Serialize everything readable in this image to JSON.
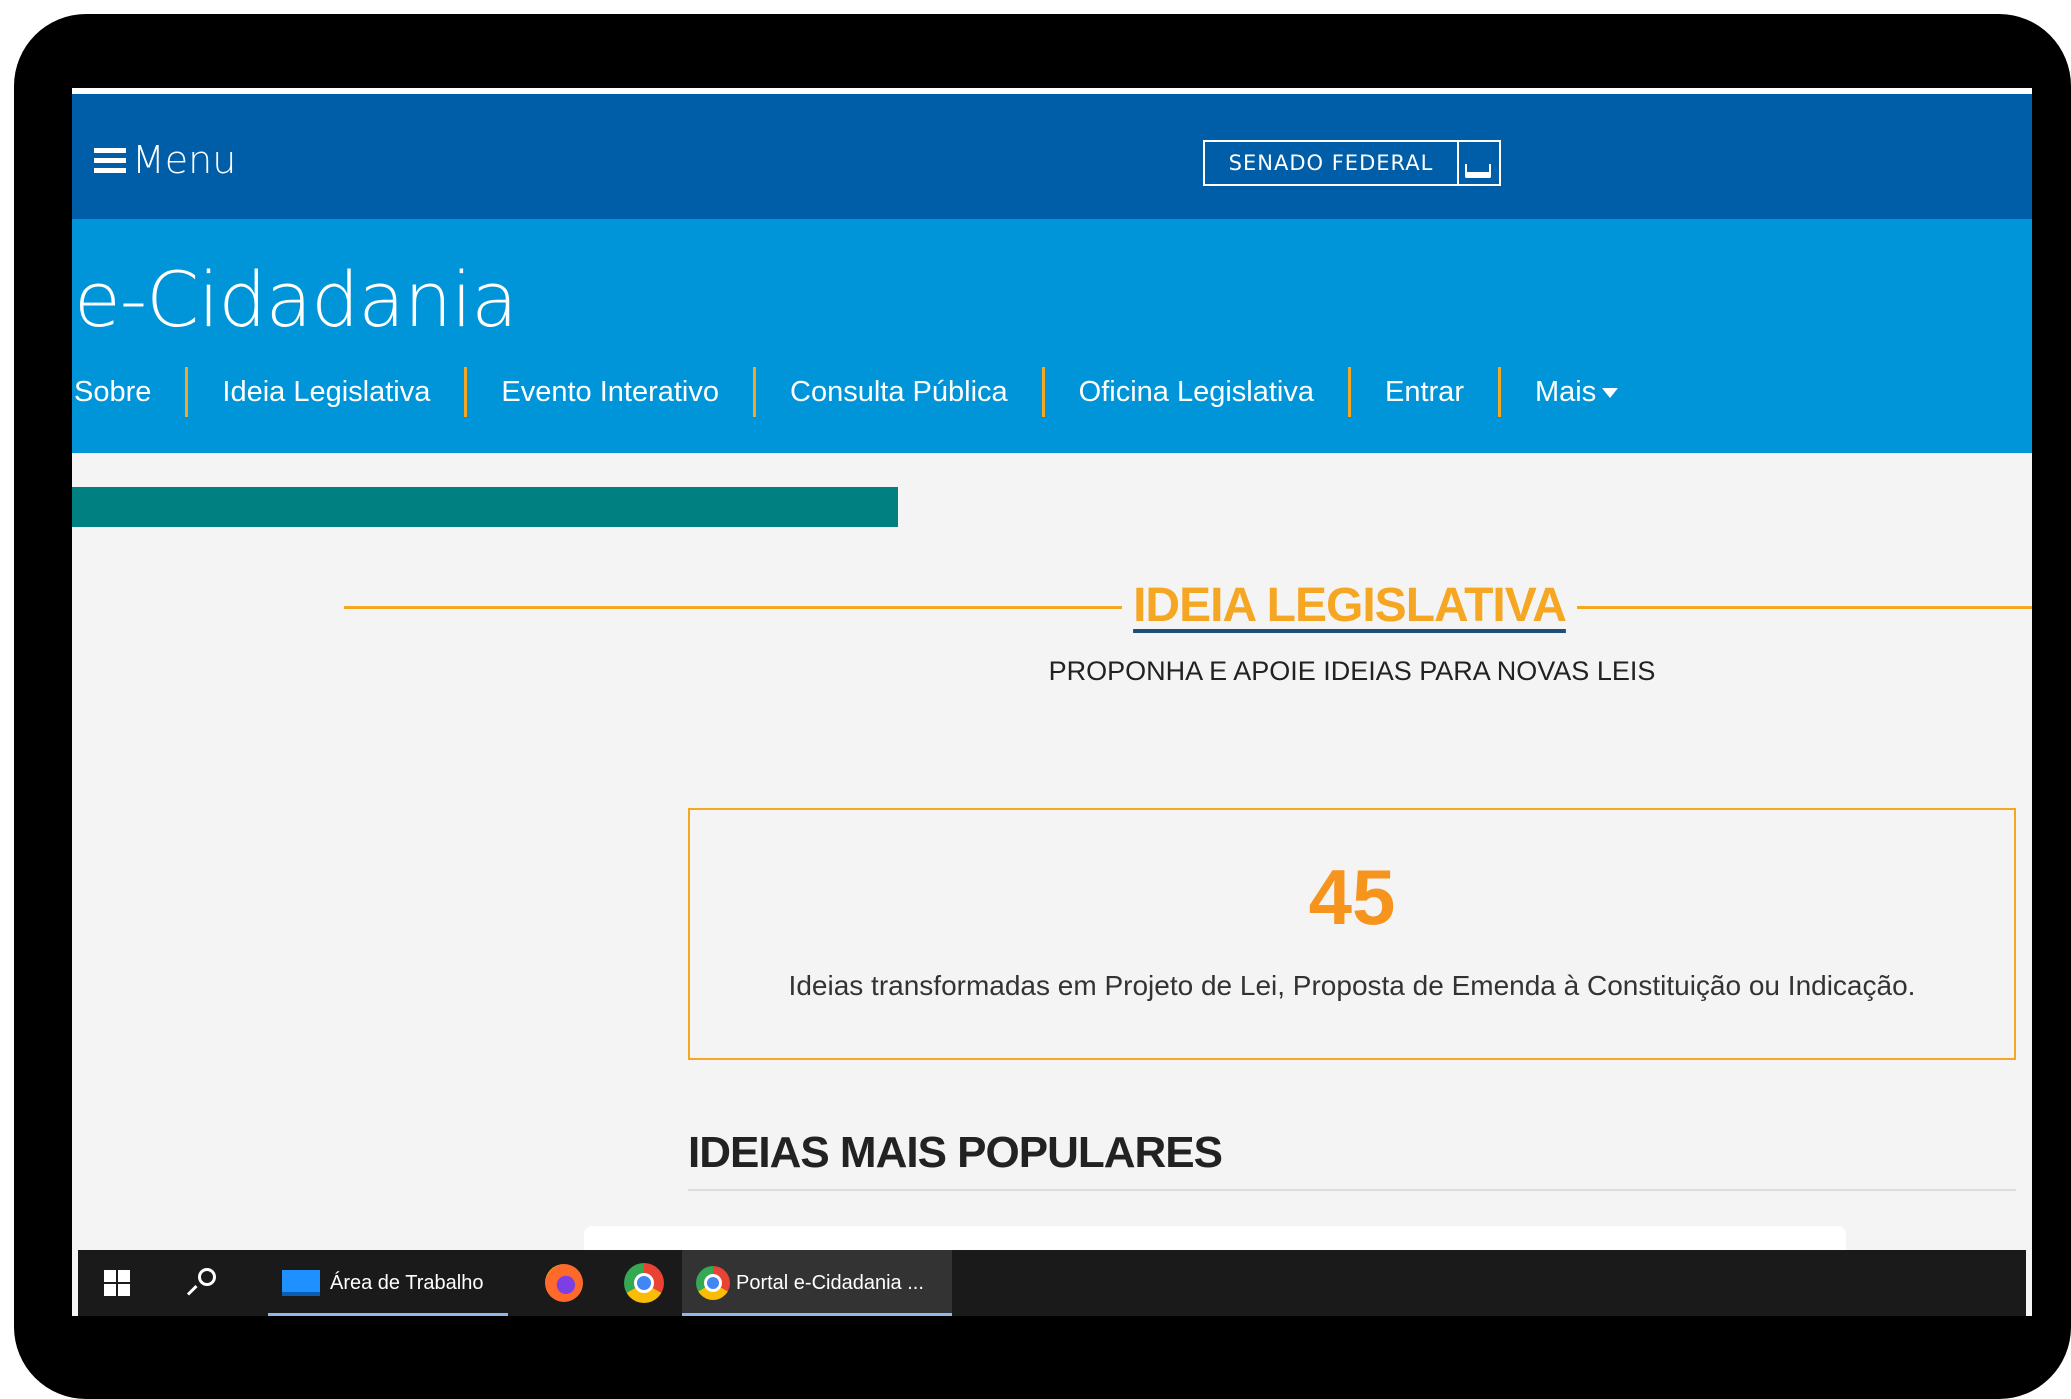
{
  "header": {
    "menu_label": "Menu",
    "senado_label": "SENADO FEDERAL"
  },
  "site": {
    "brand": "e-Cidadania",
    "nav": [
      "Sobre",
      "Ideia Legislativa",
      "Evento Interativo",
      "Consulta Pública",
      "Oficina Legislativa",
      "Entrar",
      "Mais"
    ]
  },
  "main": {
    "title": "IDEIA LEGISLATIVA",
    "subtitle": "PROPONHA E APOIE IDEIAS PARA NOVAS LEIS",
    "stats_number": "45",
    "stats_description": "Ideias transformadas em Projeto de Lei, Proposta de Emenda à Constituição ou Indicação.",
    "popular_heading": "IDEIAS MAIS POPULARES"
  },
  "taskbar": {
    "desktop_label": "Área de Trabalho",
    "chrome_window_label": "Portal e-Cidadania ..."
  },
  "colors": {
    "top_bar": "#005ea8",
    "sub_header": "#0095d9",
    "accent_orange": "#f5a623",
    "teal": "#008080"
  },
  "icons": [
    "hamburger-icon",
    "senado-logo-icon",
    "caret-down-icon",
    "windows-start-icon",
    "search-icon",
    "desktop-icon",
    "firefox-icon",
    "chrome-icon"
  ]
}
